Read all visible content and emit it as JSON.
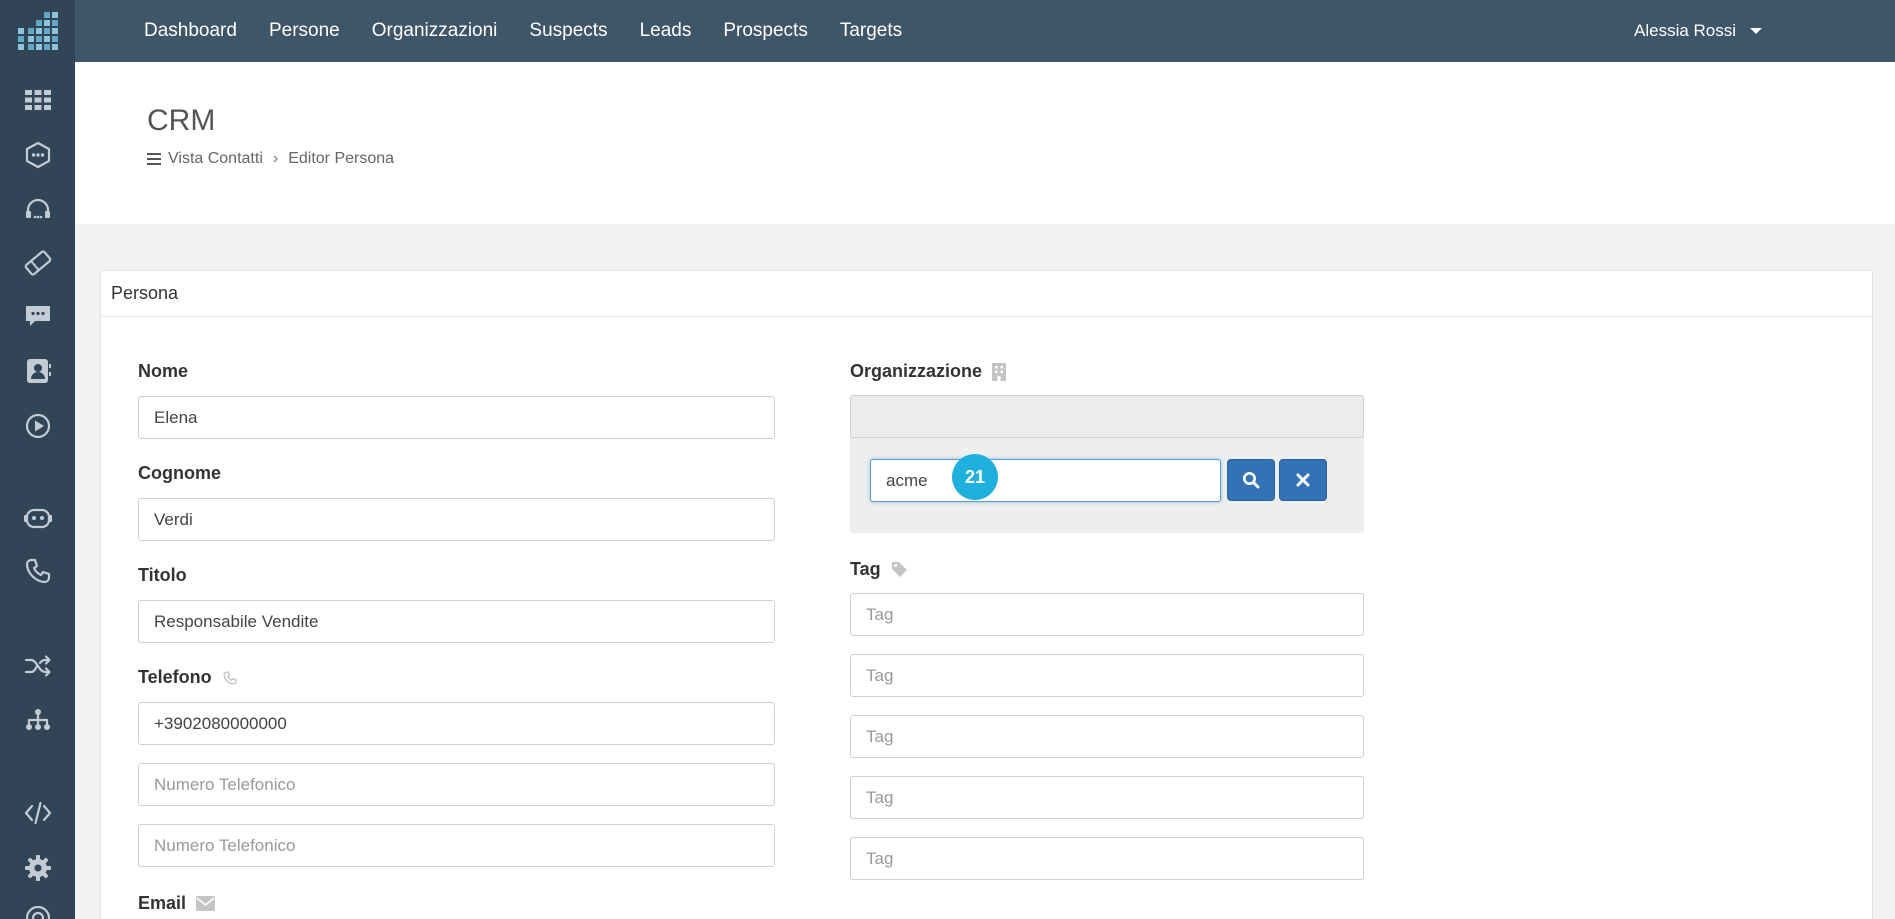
{
  "nav": {
    "items": [
      "Dashboard",
      "Persone",
      "Organizzazioni",
      "Suspects",
      "Leads",
      "Prospects",
      "Targets"
    ],
    "user_name": "Alessia Rossi"
  },
  "sidebar": {
    "icons": [
      "apps-grid-icon",
      "hexagon-dots-icon",
      "headset-icon",
      "ticket-icon",
      "chat-icon",
      "contact-card-icon",
      "play-circle-icon",
      "robot-icon",
      "phone-icon",
      "shuffle-icon",
      "org-tree-icon",
      "code-icon",
      "gear-icon",
      "lifebuoy-icon"
    ]
  },
  "header": {
    "title": "CRM",
    "breadcrumb": [
      "Vista Contatti",
      "Editor Persona"
    ]
  },
  "panel": {
    "title": "Persona"
  },
  "form": {
    "nome": {
      "label": "Nome",
      "value": "Elena"
    },
    "cognome": {
      "label": "Cognome",
      "value": "Verdi"
    },
    "titolo": {
      "label": "Titolo",
      "value": "Responsabile Vendite"
    },
    "telefono": {
      "label": "Telefono",
      "value": "+3902080000000",
      "placeholder": "Numero Telefonico"
    },
    "email": {
      "label": "Email"
    },
    "organizzazione": {
      "label": "Organizzazione",
      "search_value": "acme"
    },
    "tag": {
      "label": "Tag",
      "placeholder": "Tag"
    }
  },
  "step_badge": "21",
  "colors": {
    "topbar": "#3f5568",
    "sidebar": "#324556",
    "button": "#3373b5",
    "badge": "#1fb0dd"
  }
}
